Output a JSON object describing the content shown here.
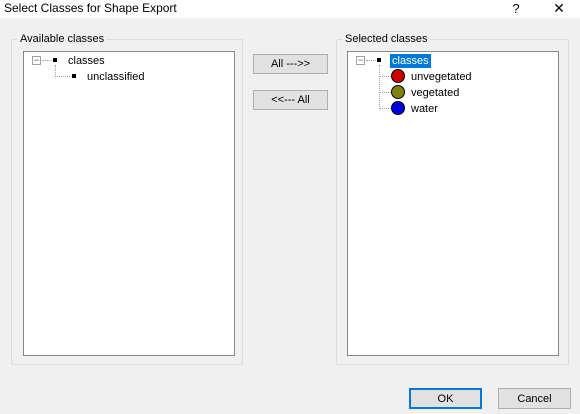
{
  "window": {
    "title": "Select Classes for Shape Export",
    "help_label": "?",
    "close_label": "✕"
  },
  "available": {
    "label": "Available classes",
    "root": "classes",
    "expander": "−",
    "items": [
      {
        "label": "unclassified"
      }
    ]
  },
  "selected": {
    "label": "Selected classes",
    "root": "classes",
    "expander": "−",
    "items": [
      {
        "label": "unvegetated",
        "color": "#d00000"
      },
      {
        "label": "vegetated",
        "color": "#808010"
      },
      {
        "label": "water",
        "color": "#0000e0"
      }
    ]
  },
  "buttons": {
    "all_right": "All --->>",
    "all_left": "<<--- All",
    "ok": "OK",
    "cancel": "Cancel"
  }
}
